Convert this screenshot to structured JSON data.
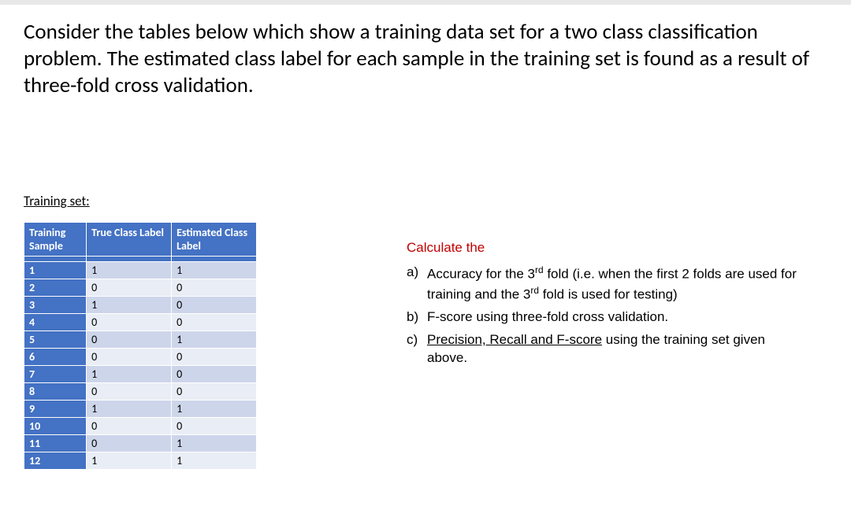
{
  "intro": "Consider the tables below which show a training data set for a two class classification problem. The estimated class label for each sample in the training set is found as a result of three-fold cross validation.",
  "subtitle": "Training set:",
  "table": {
    "headers": {
      "sample": "Training Sample",
      "true": "True Class Label",
      "est": "Estimated Class Label"
    },
    "rows": [
      {
        "s": "1",
        "t": "1",
        "e": "1"
      },
      {
        "s": "2",
        "t": "0",
        "e": "0"
      },
      {
        "s": "3",
        "t": "1",
        "e": "0"
      },
      {
        "s": "4",
        "t": "0",
        "e": "0"
      },
      {
        "s": "5",
        "t": "0",
        "e": "1"
      },
      {
        "s": "6",
        "t": "0",
        "e": "0"
      },
      {
        "s": "7",
        "t": "1",
        "e": "0"
      },
      {
        "s": "8",
        "t": "0",
        "e": "0"
      },
      {
        "s": "9",
        "t": "1",
        "e": "1"
      },
      {
        "s": "10",
        "t": "0",
        "e": "0"
      },
      {
        "s": "11",
        "t": "0",
        "e": "1"
      },
      {
        "s": "12",
        "t": "1",
        "e": "1"
      }
    ]
  },
  "questions": {
    "title": "Calculate the",
    "a": {
      "marker": "a)",
      "pre": "Accuracy for the 3",
      "ord": "rd",
      "mid": " fold (i.e. when the first 2 folds are used for training and the 3",
      "ord2": "rd",
      "post": " fold is used for testing)"
    },
    "b": {
      "marker": "b)",
      "text": "F-score using three-fold cross validation."
    },
    "c": {
      "marker": "c)",
      "ul": "Precision, Recall and F-score",
      "post": " using the training set given above."
    }
  }
}
